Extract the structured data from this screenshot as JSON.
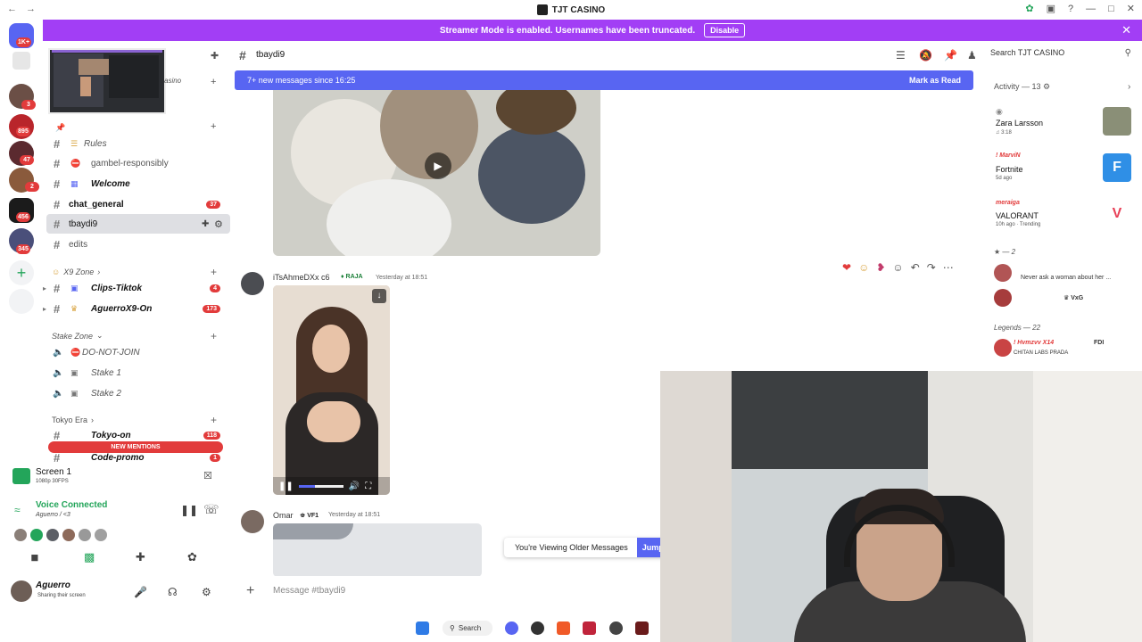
{
  "window": {
    "title": "TJT CASINO"
  },
  "banner": {
    "text": "Streamer Mode is enabled. Usernames have been truncated.",
    "disable_label": "Disable",
    "color": "#a23ef5"
  },
  "rail": {
    "badges": [
      "1K+",
      "3",
      "895",
      "47",
      "2",
      "456",
      "345"
    ]
  },
  "sidebar": {
    "server_suffix": "asino",
    "channels": [
      {
        "label": "Rules",
        "name": "rules"
      },
      {
        "label": "gambel-responsibly",
        "name": "gambel-responsibly"
      },
      {
        "label": "Welcome",
        "name": "welcome"
      },
      {
        "label": "chat_general",
        "name": "chat-general",
        "count": "37"
      },
      {
        "label": "tbaydi9",
        "name": "tbaydi9"
      },
      {
        "label": "edits",
        "name": "edits"
      }
    ],
    "cat_x9": "X9 Zone",
    "x9_channels": [
      {
        "label": "Clips-Tiktok",
        "count": "4"
      },
      {
        "label": "AguerroX9-On",
        "count": "173"
      }
    ],
    "cat_stake": "Stake Zone",
    "stake_channels": [
      "DO-NOT-JOIN",
      "Stake 1",
      "Stake 2"
    ],
    "cat_tokyo": "Tokyo Era",
    "tokyo_channels": [
      {
        "label": "Tokyo-on",
        "count": "118"
      },
      {
        "label": "Code-promo",
        "count": "1"
      }
    ],
    "new_mentions": "NEW MENTIONS"
  },
  "bottom_left": {
    "screen_title": "Screen 1",
    "screen_sub": "1080p 30FPS",
    "voice_status": "Voice Connected",
    "voice_channel": "Aguerro / <3",
    "user_name": "Aguerro",
    "user_status": "Sharing their screen"
  },
  "chat_header": {
    "channel": "tbaydi9"
  },
  "new_messages": {
    "text": "7+ new messages since 16:25",
    "mark_read": "Mark as Read"
  },
  "messages": [
    {
      "author": "iTsAhmeDXx c6",
      "role": "RAJA",
      "time": "Yesterday at 18:51"
    },
    {
      "author": "Omar",
      "role": "VF1",
      "time": "Yesterday at 18:51"
    }
  ],
  "older_bar": {
    "text": "You're Viewing Older Messages",
    "jump": "Jump"
  },
  "composer": {
    "placeholder": "Message #tbaydi9"
  },
  "right_panel": {
    "search_placeholder": "Search TJT CASINO",
    "activity_header": "Activity — 13",
    "activities": [
      {
        "user": "",
        "title": "Zara Larsson",
        "sub": "♫ 3:18"
      },
      {
        "user": "! MarviN",
        "title": "Fortnite",
        "sub": "5d ago"
      },
      {
        "user": "meraiga",
        "title": "VALORANT",
        "sub": "10h ago · Trending"
      }
    ],
    "group_2": "2",
    "member_msg": "Never ask a woman about her ...",
    "member_tag": "VxG",
    "group_legends": "Legends — 22",
    "legend_name": "! Hvmzvv X14",
    "legend_tag": "FDI",
    "legend_sub": "CHITAN LABS PRADA"
  },
  "taskbar": {
    "search_label": "Search"
  },
  "colors": {
    "accent": "#5865f2",
    "online": "#23a55a",
    "badge": "#e23b3b"
  }
}
